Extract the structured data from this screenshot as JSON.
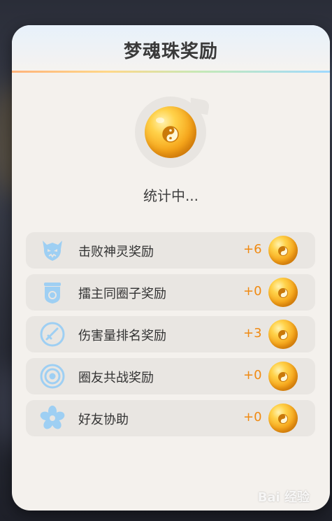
{
  "dialog": {
    "title": "梦魂珠奖励",
    "status_text": "统计中..."
  },
  "rewards": [
    {
      "label": "击败神灵奖励",
      "value": "+6",
      "icon": "demon-mask-icon"
    },
    {
      "label": "擂主同圈子奖励",
      "value": "+0",
      "icon": "host-badge-icon"
    },
    {
      "label": "伤害量排名奖励",
      "value": "+3",
      "icon": "sword-icon"
    },
    {
      "label": "圈友共战奖励",
      "value": "+0",
      "icon": "target-icon"
    },
    {
      "label": "好友协助",
      "value": "+0",
      "icon": "flower-icon"
    }
  ],
  "watermark": "Bai 经验",
  "colors": {
    "accent_value": "#f08a12",
    "icon_blue": "#9ecff3",
    "orb_gold": "#f6a51a"
  }
}
